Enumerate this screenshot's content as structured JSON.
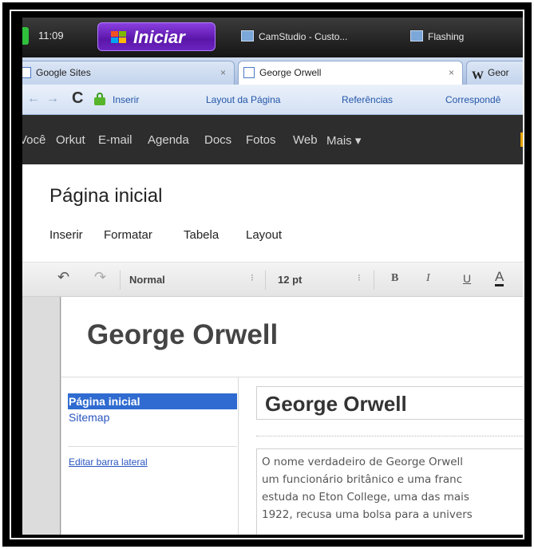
{
  "taskbar": {
    "clock": "11:09",
    "start_label": "Iniciar",
    "tasks": [
      "CamStudio - Custo...",
      "Flashing"
    ]
  },
  "tabs": [
    {
      "label": "Google Sites",
      "close": "×",
      "active": false
    },
    {
      "label": "George Orwell",
      "close": "×",
      "active": true
    },
    {
      "label": "Geor",
      "icon": "W",
      "active": false
    }
  ],
  "addressbar": {
    "back": "←",
    "forward": "→",
    "reload": "C",
    "ribbon": [
      "Inserir",
      "Layout da Página",
      "Referências",
      "Correspondê"
    ]
  },
  "google_bar": [
    "Você",
    "Orkut",
    "E-mail",
    "Agenda",
    "Docs",
    "Fotos",
    "Web",
    "Mais ▾"
  ],
  "editor": {
    "page_title": "Página inicial",
    "menu": [
      "Inserir",
      "Formatar",
      "Tabela",
      "Layout"
    ],
    "toolbar": {
      "undo": "↶",
      "redo": "↷",
      "style": "Normal",
      "size": "12 pt",
      "bold": "B",
      "italic": "I",
      "underline": "U",
      "text_color": "A",
      "spinner": "⁝"
    }
  },
  "site": {
    "title": "George Orwell",
    "nav": {
      "selected": "Página inicial",
      "items": [
        "Sitemap"
      ],
      "edit_sidebar": "Editar barra lateral"
    },
    "main_title": "George Orwell",
    "body_lines": [
      "O nome verdadeiro de George Orwell",
      "um funcionário britânico e uma franc",
      "estuda no Eton College, uma das mais",
      "1922, recusa uma bolsa para a univers"
    ]
  },
  "colors": {
    "taskbar": "#1e1e1e",
    "start": "#6b25c0",
    "tabstrip": "#bcd0ec",
    "google_bar": "#2d2d2d",
    "nav_selected": "#2f6bd0",
    "link": "#2a56c0"
  }
}
